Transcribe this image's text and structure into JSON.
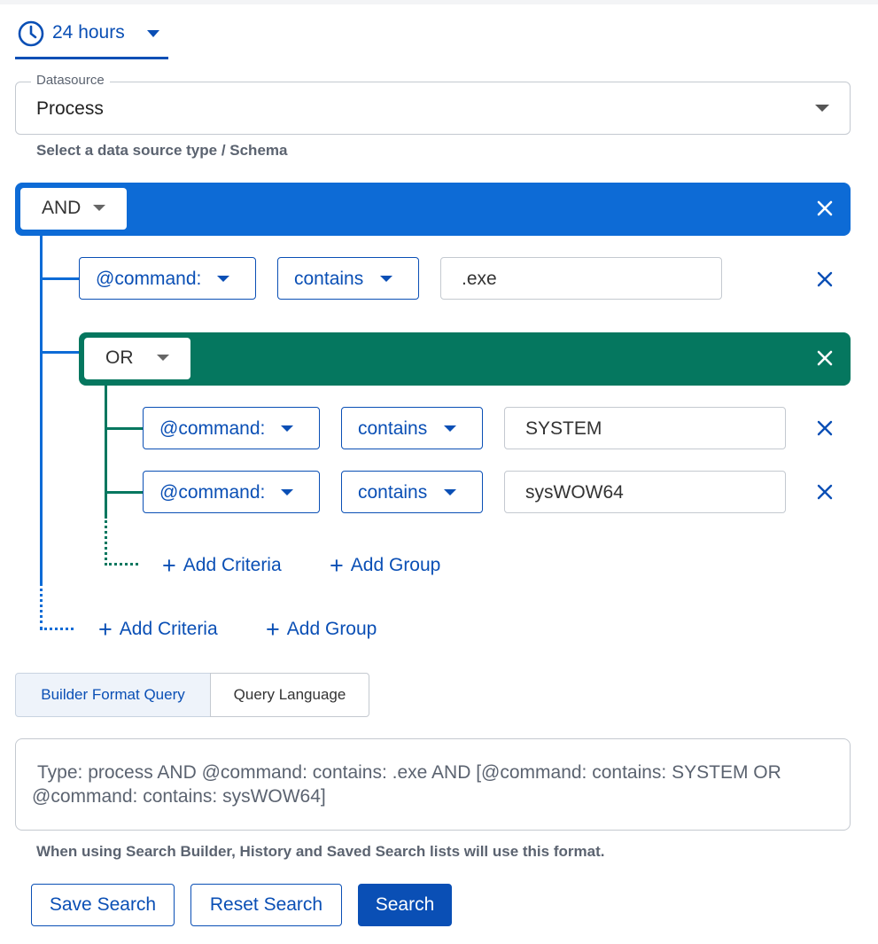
{
  "time_range": {
    "label": "24 hours",
    "icon": "clock-icon"
  },
  "datasource": {
    "legend": "Datasource",
    "value": "Process",
    "hint": "Select a data source type / Schema"
  },
  "root_group": {
    "operator": "AND",
    "criteria": [
      {
        "field": "@command:",
        "condition": "contains",
        "value": ".exe"
      }
    ],
    "subgroup": {
      "operator": "OR",
      "criteria": [
        {
          "field": "@command:",
          "condition": "contains",
          "value": "SYSTEM"
        },
        {
          "field": "@command:",
          "condition": "contains",
          "value": "sysWOW64"
        }
      ],
      "add_criteria": "Add Criteria",
      "add_group": "Add Group"
    },
    "add_criteria": "Add Criteria",
    "add_group": "Add Group"
  },
  "tabs": [
    {
      "label": "Builder Format Query",
      "active": true
    },
    {
      "label": "Query Language",
      "active": false
    }
  ],
  "query": {
    "text": "Type: process AND @command: contains: .exe AND [@command: contains: SYSTEM OR @command: contains: sysWOW64]",
    "hint": "When using Search Builder, History and Saved Search lists will use this format."
  },
  "buttons": {
    "save": "Save Search",
    "reset": "Reset Search",
    "search": "Search"
  },
  "colors": {
    "accent": "#0a4fb5",
    "and_group": "#0d6bd6",
    "or_group": "#05775f"
  }
}
